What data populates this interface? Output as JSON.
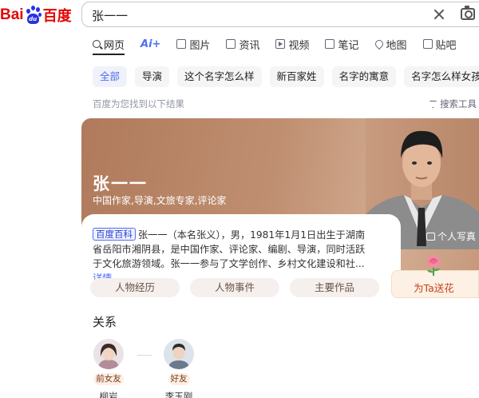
{
  "logo": {
    "latin": "Bai",
    "pad": "du",
    "chinese": "百度"
  },
  "search": {
    "value": "张一一"
  },
  "tabs": [
    {
      "label": "网页",
      "icon": "search-icon"
    },
    {
      "label": "Ai+",
      "icon": ""
    },
    {
      "label": "图片",
      "icon": "image-icon"
    },
    {
      "label": "资讯",
      "icon": "news-icon"
    },
    {
      "label": "视频",
      "icon": "video-icon"
    },
    {
      "label": "笔记",
      "icon": "note-icon"
    },
    {
      "label": "地图",
      "icon": "map-icon"
    },
    {
      "label": "贴吧",
      "icon": "tieba-icon"
    }
  ],
  "chips": [
    "全部",
    "导演",
    "这个名字怎么样",
    "新百家姓",
    "名字的寓意",
    "名字怎么样女孩"
  ],
  "result_info": "百度为您找到以下结果",
  "filter_label": "搜索工具",
  "hero": {
    "name": "张一一",
    "tags": "中国作家,导演,文旅专家,评论家",
    "personal_photo": "个人写真"
  },
  "summary": {
    "badge": "百度百科",
    "text": "张一一（本名张义），男，1981年1月1日出生于湖南省岳阳市湘阴县，是中国作家、评论家、编剧、导演，同时活跃于文化旅游领域。张一一参与了文学创作、乡村文化建设和社...",
    "more": "详情"
  },
  "pills": [
    "人物经历",
    "人物事件",
    "主要作品"
  ],
  "gift_label": "为Ta送花",
  "relations": {
    "title": "关系",
    "items": [
      {
        "tag": "前女友",
        "name": "柳岩"
      },
      {
        "tag": "好友",
        "name": "李玉刚"
      }
    ]
  },
  "colors": {
    "brand_red": "#e10601",
    "brand_blue": "#2932e1",
    "accent": "#4e6ef2",
    "hero_bg": "#bf8e70"
  }
}
